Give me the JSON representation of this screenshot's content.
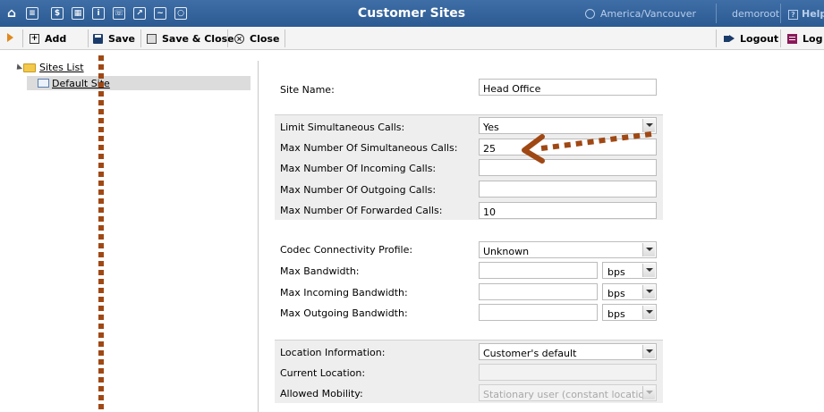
{
  "window": {
    "title": "Customer Sites",
    "timezone": "America/Vancouver",
    "user": "demoroot",
    "help_label": "Help"
  },
  "top_icons": [
    "home-icon",
    "list-icon",
    "dollar-icon",
    "grid-icon",
    "user-icon",
    "phone-icon",
    "contact-icon",
    "chart-icon",
    "search-icon"
  ],
  "toolbar": {
    "add_label": "Add",
    "save_label": "Save",
    "save_close_label": "Save & Close",
    "close_label": "Close",
    "logout_label": "Logout",
    "log_label": "Log"
  },
  "tree": {
    "root_label": "Sites List",
    "selected_item": "Default Site"
  },
  "form": {
    "site_name": {
      "label": "Site Name:",
      "value": "Head Office"
    },
    "limit_calls": {
      "label": "Limit Simultaneous Calls:",
      "value": "Yes"
    },
    "max_simultaneous": {
      "label": "Max Number Of Simultaneous Calls:",
      "value": "25"
    },
    "max_incoming": {
      "label": "Max Number Of Incoming Calls:",
      "value": ""
    },
    "max_outgoing": {
      "label": "Max Number Of Outgoing Calls:",
      "value": ""
    },
    "max_forwarded": {
      "label": "Max Number Of Forwarded Calls:",
      "value": "10"
    },
    "codec_profile": {
      "label": "Codec Connectivity Profile:",
      "value": "Unknown"
    },
    "max_bandwidth": {
      "label": "Max Bandwidth:",
      "value": "",
      "unit": "bps"
    },
    "max_incoming_bandwidth": {
      "label": "Max Incoming Bandwidth:",
      "value": "",
      "unit": "bps"
    },
    "max_outgoing_bandwidth": {
      "label": "Max Outgoing Bandwidth:",
      "value": "",
      "unit": "bps"
    },
    "location_info": {
      "label": "Location Information:",
      "value": "Customer's default"
    },
    "current_location": {
      "label": "Current Location:",
      "value": ""
    },
    "allowed_mobility": {
      "label": "Allowed Mobility:",
      "value": "Stationary user (constant location)"
    }
  },
  "colors": {
    "title_bar": "#2f5f97",
    "annotation": "#a04814",
    "group_bg": "#eeeeee"
  }
}
